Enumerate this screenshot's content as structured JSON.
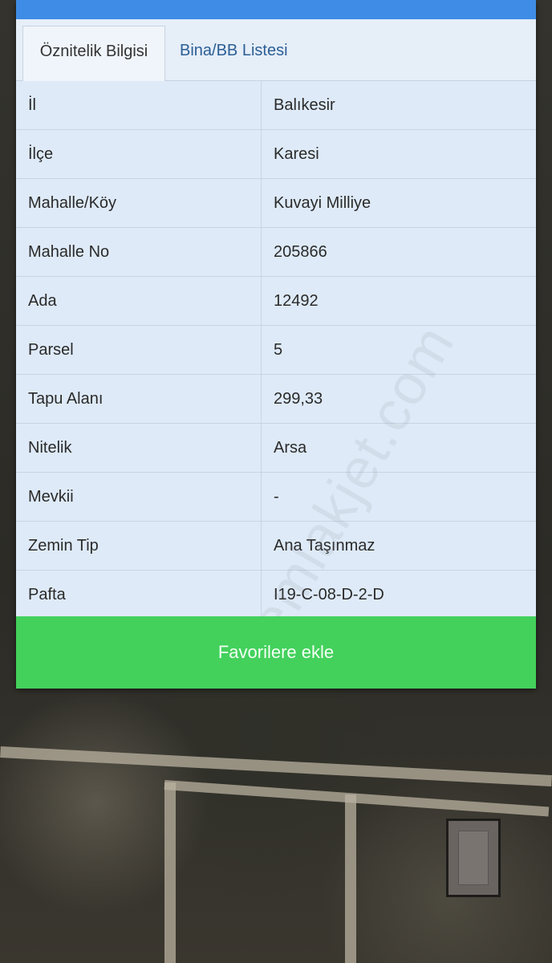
{
  "tabs": [
    {
      "label": "Öznitelik Bilgisi",
      "active": true
    },
    {
      "label": "Bina/BB Listesi",
      "active": false
    }
  ],
  "rows": [
    {
      "key": "İl",
      "value": "Balıkesir"
    },
    {
      "key": "İlçe",
      "value": "Karesi"
    },
    {
      "key": "Mahalle/Köy",
      "value": "Kuvayi Milliye"
    },
    {
      "key": "Mahalle No",
      "value": "205866"
    },
    {
      "key": "Ada",
      "value": "12492"
    },
    {
      "key": "Parsel",
      "value": "5"
    },
    {
      "key": "Tapu Alanı",
      "value": "299,33"
    },
    {
      "key": "Nitelik",
      "value": "Arsa"
    },
    {
      "key": "Mevkii",
      "value": "-"
    },
    {
      "key": "Zemin Tip",
      "value": "Ana Taşınmaz"
    },
    {
      "key": "Pafta",
      "value": "I19-C-08-D-2-D"
    }
  ],
  "favorite_button": "Favorilere ekle",
  "watermark": "emlakjet.com",
  "colors": {
    "topbar": "#3e8ce6",
    "button": "#43d15c",
    "panel": "#dde9f7"
  }
}
